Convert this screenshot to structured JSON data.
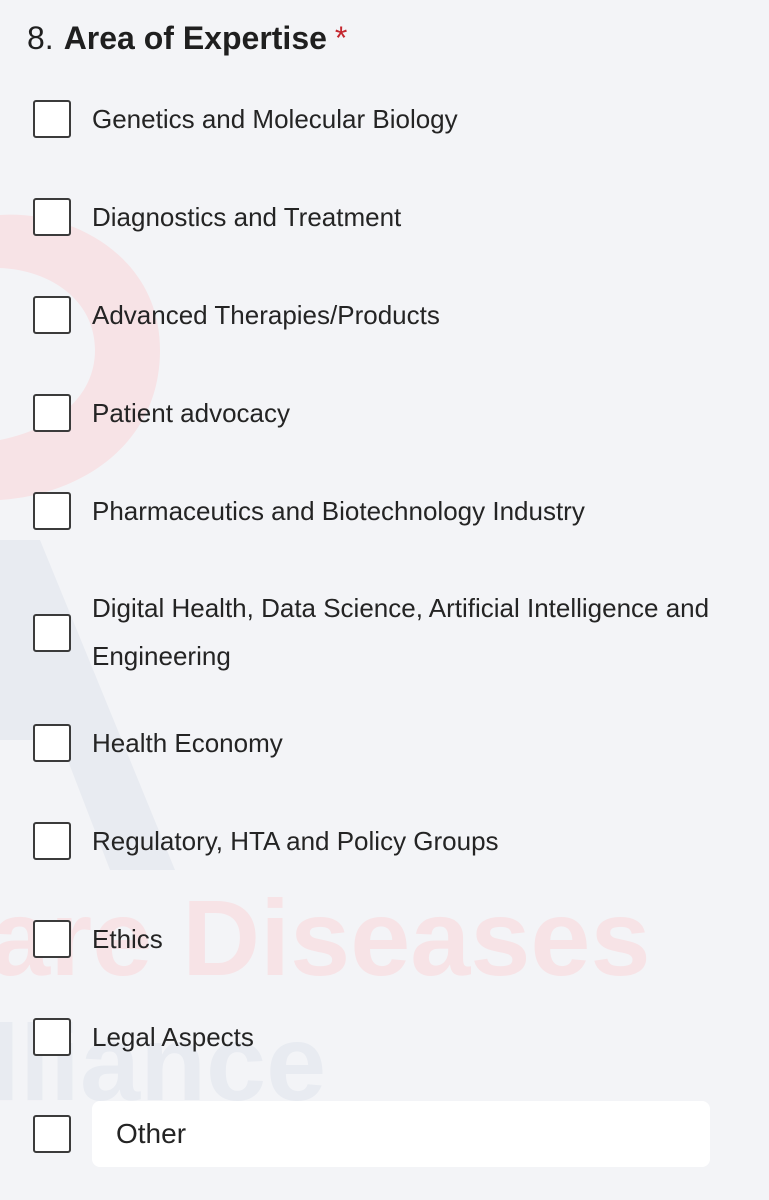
{
  "question": {
    "number": "8.",
    "title": "Area of Expertise",
    "required_marker": "*"
  },
  "options": [
    {
      "label": "Genetics and Molecular Biology",
      "checked": false
    },
    {
      "label": "Diagnostics and Treatment",
      "checked": false
    },
    {
      "label": "Advanced Therapies/Products",
      "checked": false
    },
    {
      "label": "Patient advocacy",
      "checked": false
    },
    {
      "label": "Pharmaceutics and Biotechnology Industry",
      "checked": false
    },
    {
      "label": "Digital Health, Data Science, Artificial Intelligence and Engineering",
      "checked": false
    },
    {
      "label": "Health Economy",
      "checked": false
    },
    {
      "label": "Regulatory, HTA and Policy Groups",
      "checked": false
    },
    {
      "label": "Ethics",
      "checked": false
    },
    {
      "label": "Legal Aspects",
      "checked": false
    }
  ],
  "other": {
    "checked": false,
    "placeholder": "Other",
    "value": ""
  },
  "watermark": {
    "line1": "are Diseases",
    "line2": "lliance",
    "logo_letter": "A"
  },
  "colors": {
    "required": "#c4262e",
    "background": "#f3f4f7",
    "watermark_red": "#f6dfe3",
    "watermark_blue": "#e6e9f0"
  }
}
